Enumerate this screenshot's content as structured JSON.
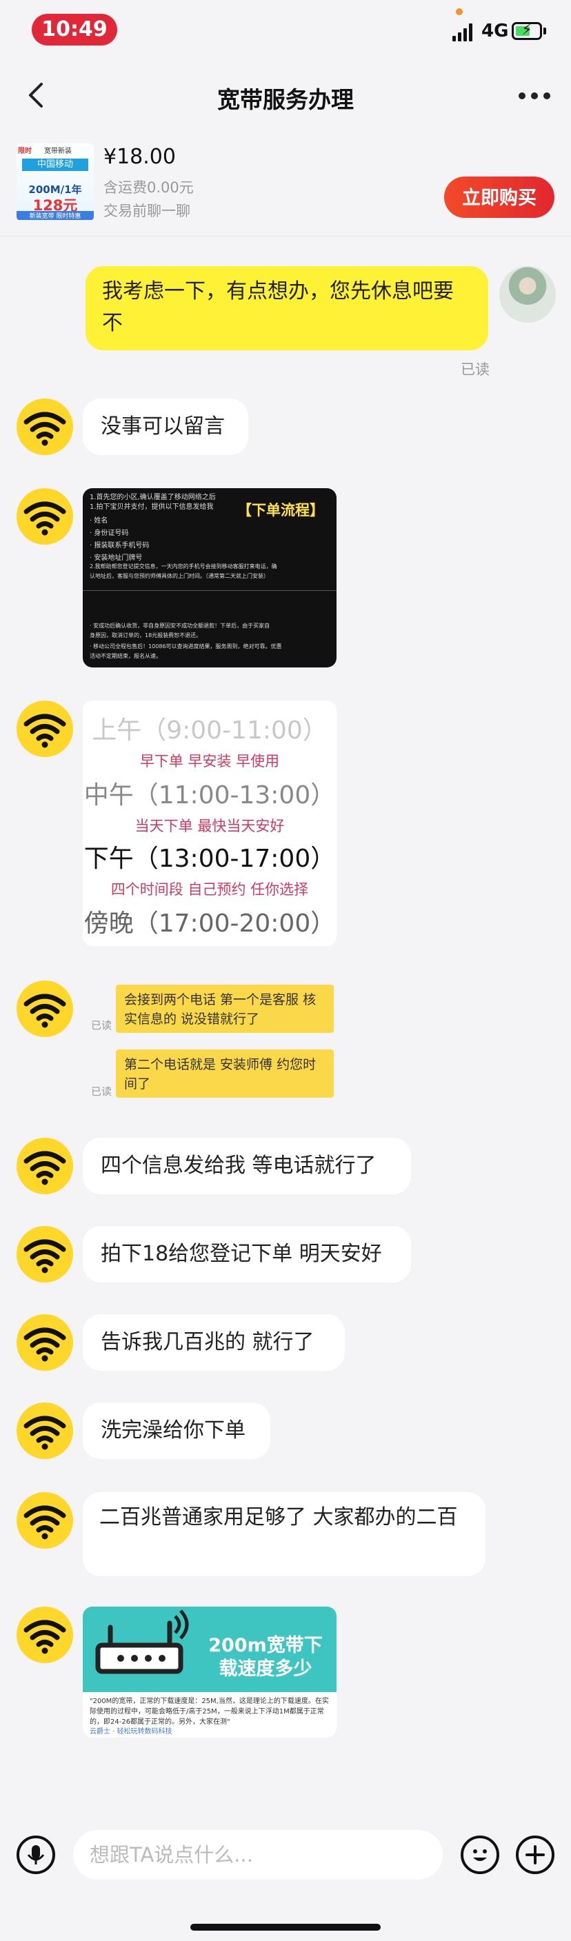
{
  "status_bar": {
    "time": "10:49",
    "network": "4G"
  },
  "nav": {
    "title": "宽带服务办理"
  },
  "product": {
    "thumb": {
      "tag1": "限时",
      "tag2": "宽带新装",
      "brand": "中国移动",
      "speed": "200M/1年",
      "price": "128元",
      "footer": "新装宽带 限时特惠"
    },
    "price": "¥18.00",
    "shipping": "含运费0.00元",
    "trade": "交易前聊一聊",
    "buy_label": "立即购买"
  },
  "messages": {
    "me_1": "我考虑一下，有点想办，您先休息吧要不",
    "me_1_status": "已读",
    "m1": "没事可以留言",
    "m2": "四个信息发给我 等电话就行了",
    "m3": "拍下18给您登记下单 明天安好",
    "m4": "告诉我几百兆的 就行了",
    "m5": "洗完澡给你下单",
    "m6": "二百兆普通家用足够了 大家都办的二百"
  },
  "flow_card": {
    "title": "【下单流程】",
    "lines": [
      "1.首先您的小区,确认覆盖了移动网络之后",
      "1.拍下宝贝并支付，提供以下信息发给我",
      "· 姓名",
      "· 身份证号码",
      "· 报装联系手机号码",
      "· 安装地址门牌号",
      "2.我帮助帮您登记提交信息，一天内您的手机号会接到移动客服打来电话，确",
      "认地址后，客服与您预约师傅具体的上门时间。（通常第二天就上门安装）",
      "· 安成功后确认收货，非自身原因安不成功全额退款！下单后，由于买家自",
      "  身原因，取消订单的，18元报装费恕不退还。",
      "· 移动公司全程包售后！10086可以查询进度结果，服务周到，绝对可靠。优惠",
      "  活动不定期结束，报名从速。"
    ]
  },
  "slots_card": {
    "s1": "上午（9:00-11:00）",
    "s1_note": "早下单 早安装 早使用",
    "s2": "中午（11:00-13:00）",
    "s2_note": "当天下单 最快当天安好",
    "s3": "下午（13:00-17:00）",
    "s3_note": "四个时间段 自己预约 任你选择",
    "s4": "傍晚（17:00-20:00）"
  },
  "nested_card": {
    "b1": "会接到两个电话 第一个是客服 核实信息的 说没错就行了",
    "b1_status": "已读",
    "b2": "第二个电话就是 安装师傅 约您时间了",
    "b2_status": "已读"
  },
  "router_card": {
    "title": "200m宽带下载速度多少",
    "desc": "\"200M的宽带，正常的下载速度是：25M,当然，这是理论上的下载速度。在实际使用的过程中，可能会略低于/高于25M，一般来说上下浮动1M都属于正常的，即24-26都属于正常的。另外，大家在测\"",
    "source": "云爵士 · 轻松玩转数码科技"
  },
  "input": {
    "placeholder": "想跟TA说点什么..."
  },
  "colors": {
    "accent_red": "#e3272f",
    "bubble_yellow": "#fff236",
    "avatar_yellow": "#ffd72b"
  },
  "icons": [
    "back-icon",
    "more-icon",
    "wifi-icon",
    "voice-icon",
    "emoji-icon",
    "plus-icon",
    "router-icon"
  ]
}
